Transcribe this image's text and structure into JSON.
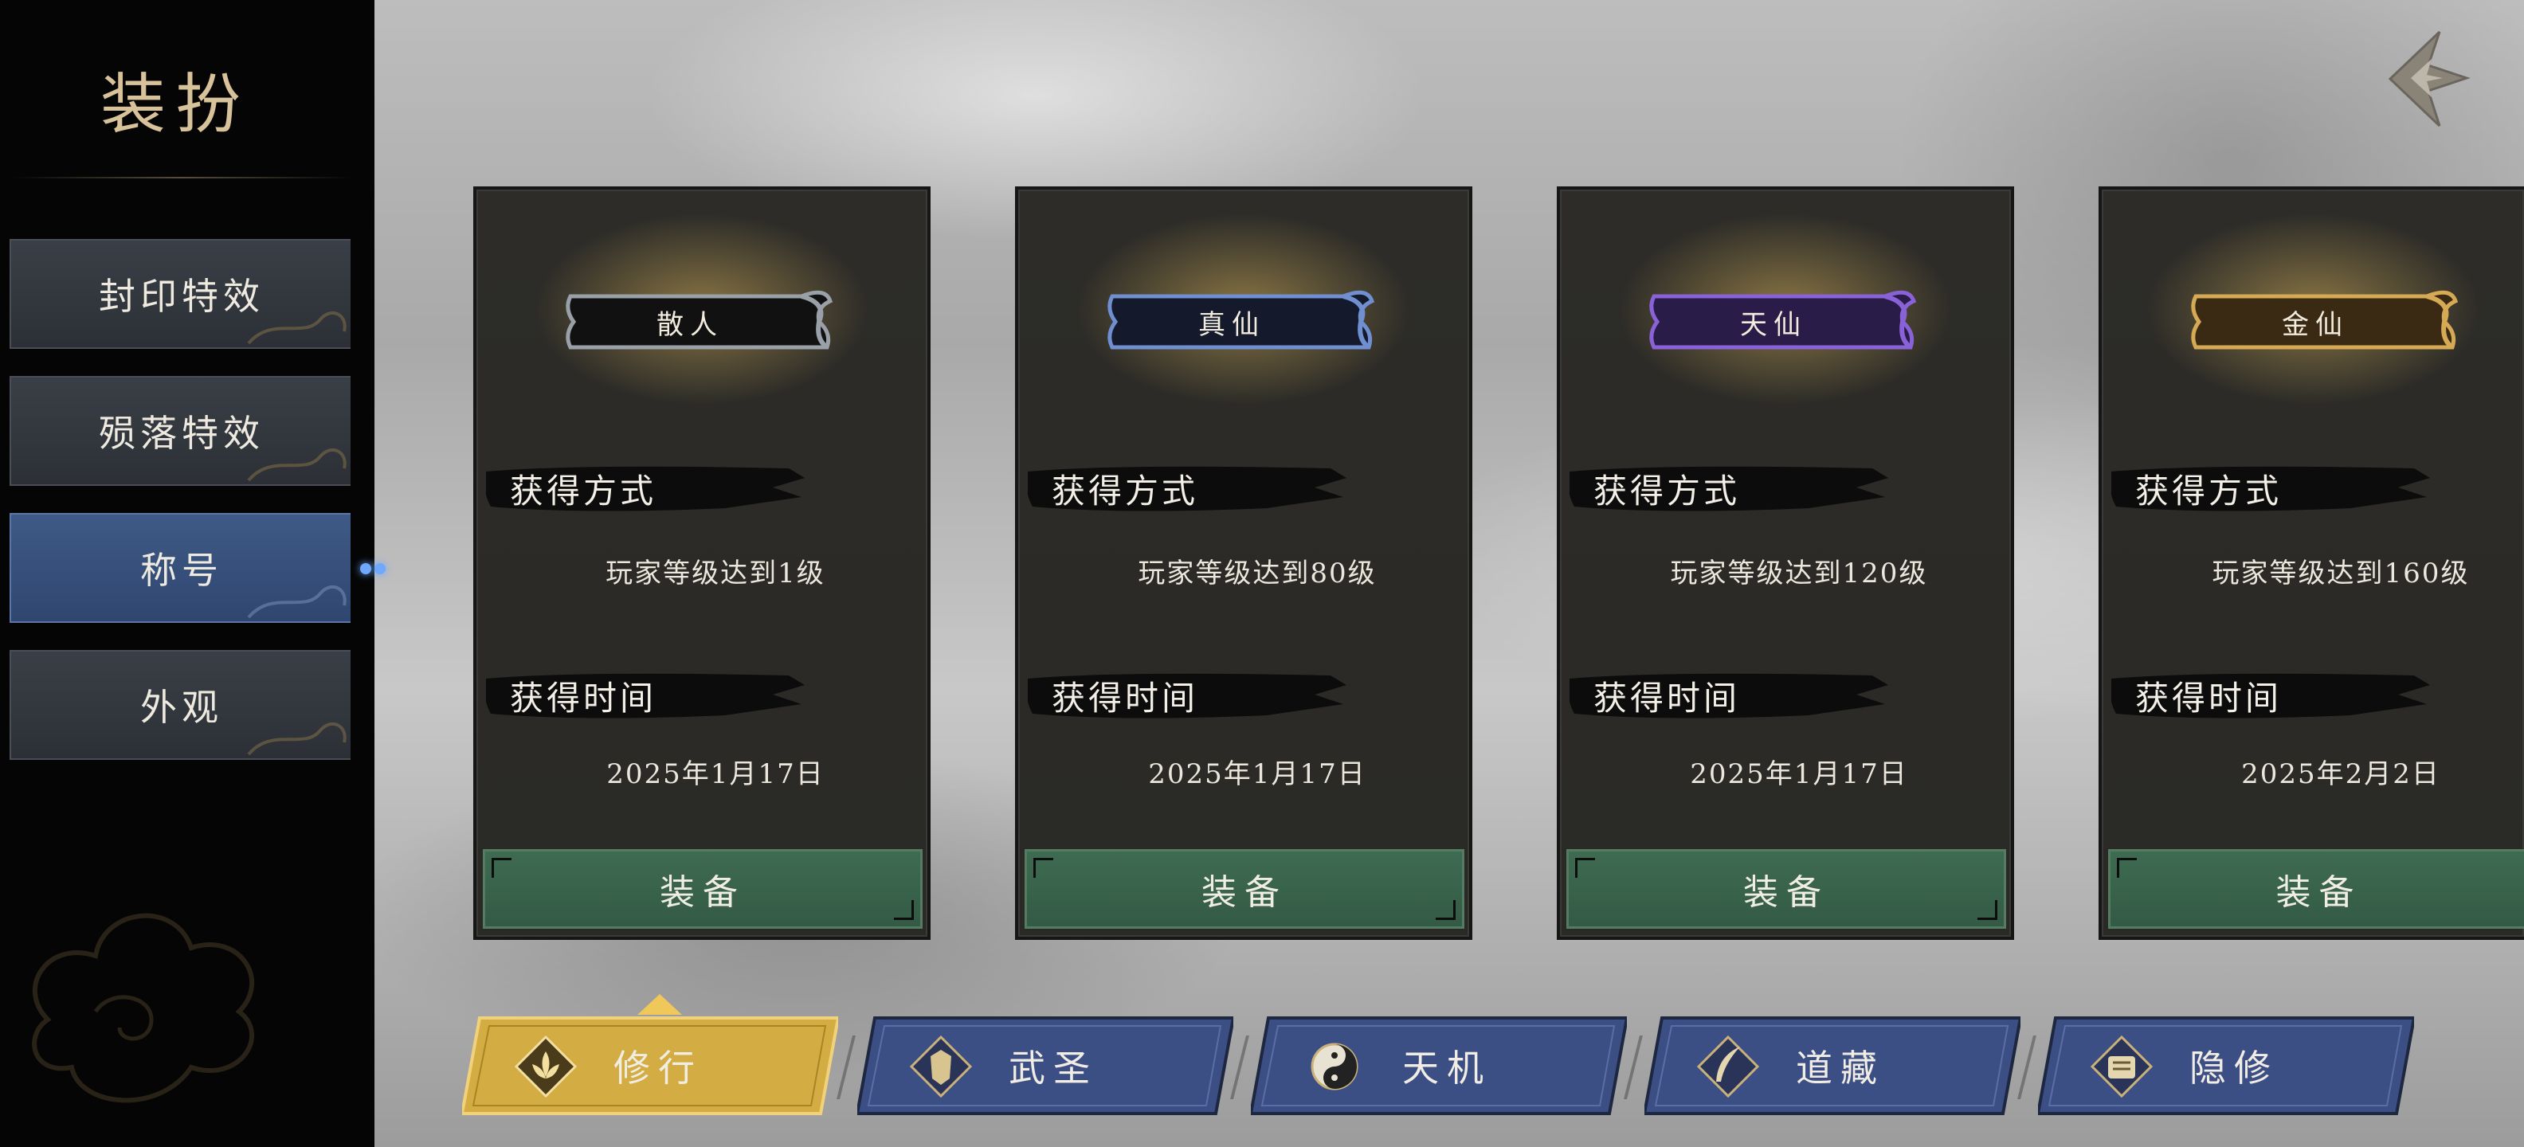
{
  "sidebar": {
    "title": "装扮",
    "items": [
      {
        "label": "封印特效",
        "active": false
      },
      {
        "label": "殒落特效",
        "active": false
      },
      {
        "label": "称号",
        "active": true
      },
      {
        "label": "外观",
        "active": false
      }
    ]
  },
  "cards": [
    {
      "title": "散人",
      "frame_color": "#9aa0a8",
      "method_label": "获得方式",
      "method": "玩家等级达到1级",
      "time_label": "获得时间",
      "time": "2025年1月17日",
      "button": "装备"
    },
    {
      "title": "真仙",
      "frame_color": "#6f8fd0",
      "method_label": "获得方式",
      "method": "玩家等级达到80级",
      "time_label": "获得时间",
      "time": "2025年1月17日",
      "button": "装备"
    },
    {
      "title": "天仙",
      "frame_color": "#8a62d8",
      "method_label": "获得方式",
      "method": "玩家等级达到120级",
      "time_label": "获得时间",
      "time": "2025年1月17日",
      "button": "装备"
    },
    {
      "title": "金仙",
      "frame_color": "#d6a955",
      "method_label": "获得方式",
      "method": "玩家等级达到160级",
      "time_label": "获得时间",
      "time": "2025年2月2日",
      "button": "装备"
    }
  ],
  "tabs": [
    {
      "label": "修行",
      "icon": "lotus-icon",
      "active": true
    },
    {
      "label": "武圣",
      "icon": "armor-icon",
      "active": false
    },
    {
      "label": "天机",
      "icon": "yin-yang-icon",
      "active": false
    },
    {
      "label": "道藏",
      "icon": "feather-icon",
      "active": false
    },
    {
      "label": "隐修",
      "icon": "scroll-icon",
      "active": false
    }
  ],
  "colors": {
    "accent_gold": "#d8b24a",
    "tab_blue": "#3c4f85",
    "equip_green": "#3f6b52",
    "sidebar_active": "#3f5a86"
  }
}
